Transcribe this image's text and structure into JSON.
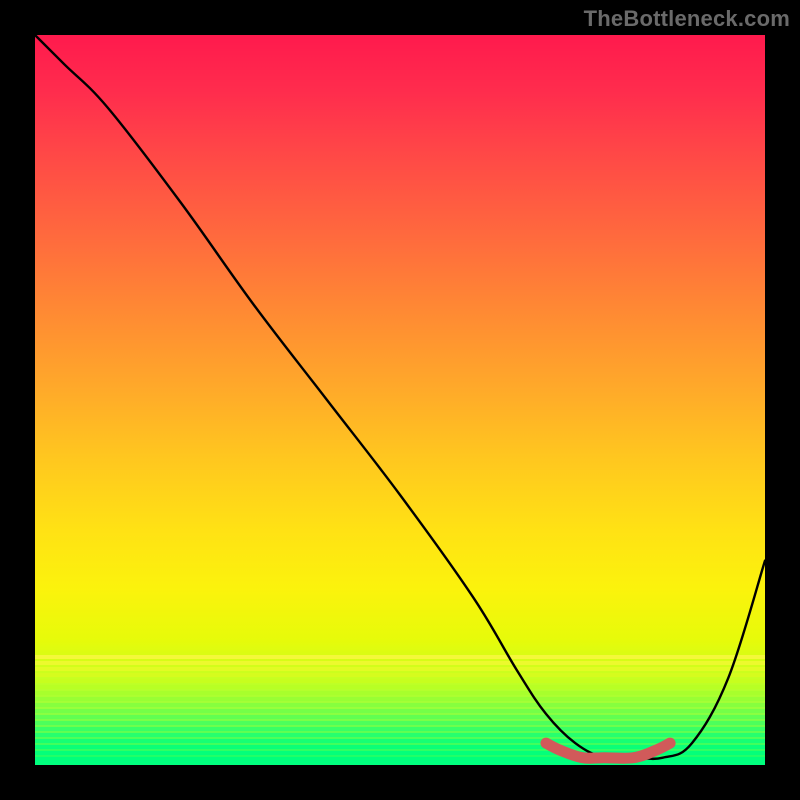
{
  "watermark": "TheBottleneck.com",
  "chart_data": {
    "type": "line",
    "title": "",
    "xlabel": "",
    "ylabel": "",
    "xlim": [
      0,
      100
    ],
    "ylim": [
      0,
      100
    ],
    "grid": false,
    "legend": false,
    "series": [
      {
        "name": "bottleneck-curve",
        "color": "#000000",
        "x": [
          0,
          4,
          10,
          20,
          30,
          40,
          50,
          60,
          66,
          70,
          74,
          78,
          82,
          86,
          90,
          95,
          100
        ],
        "values": [
          100,
          96,
          90,
          77,
          63,
          50,
          37,
          23,
          13,
          7,
          3,
          1,
          1,
          1,
          3,
          12,
          28
        ]
      },
      {
        "name": "optimal-range",
        "color": "#d15a5a",
        "x": [
          70,
          72,
          75,
          78,
          82,
          85,
          87
        ],
        "values": [
          3,
          2,
          1,
          1,
          1,
          2,
          3
        ]
      }
    ],
    "background_gradient": {
      "top": "#ff1a4d",
      "mid": "#ffe214",
      "bottom": "#0aff70"
    }
  }
}
